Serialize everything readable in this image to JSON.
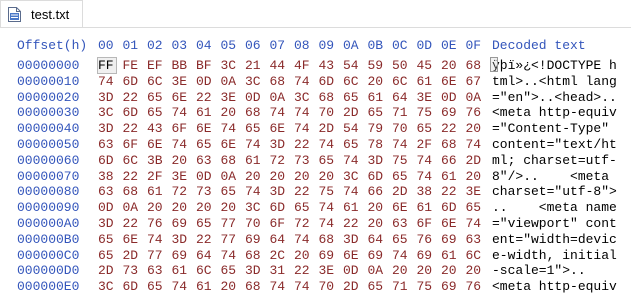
{
  "tab": {
    "label": "test.txt",
    "icon": "hex-file-icon"
  },
  "columns": {
    "offset_header": "Offset(h)",
    "byte_headers": [
      "00",
      "01",
      "02",
      "03",
      "04",
      "05",
      "06",
      "07",
      "08",
      "09",
      "0A",
      "0B",
      "0C",
      "0D",
      "0E",
      "0F"
    ],
    "decoded_header": "Decoded text"
  },
  "rows": [
    {
      "offset": "00000000",
      "bytes": [
        "FF",
        "FE",
        "EF",
        "BB",
        "BF",
        "3C",
        "21",
        "44",
        "4F",
        "43",
        "54",
        "59",
        "50",
        "45",
        "20",
        "68"
      ],
      "text": "ÿþï»¿<!DOCTYPE h"
    },
    {
      "offset": "00000010",
      "bytes": [
        "74",
        "6D",
        "6C",
        "3E",
        "0D",
        "0A",
        "3C",
        "68",
        "74",
        "6D",
        "6C",
        "20",
        "6C",
        "61",
        "6E",
        "67"
      ],
      "text": "tml>..<html lang"
    },
    {
      "offset": "00000020",
      "bytes": [
        "3D",
        "22",
        "65",
        "6E",
        "22",
        "3E",
        "0D",
        "0A",
        "3C",
        "68",
        "65",
        "61",
        "64",
        "3E",
        "0D",
        "0A"
      ],
      "text": "=\"en\">..<head>.."
    },
    {
      "offset": "00000030",
      "bytes": [
        "3C",
        "6D",
        "65",
        "74",
        "61",
        "20",
        "68",
        "74",
        "74",
        "70",
        "2D",
        "65",
        "71",
        "75",
        "69",
        "76"
      ],
      "text": "<meta http-equiv"
    },
    {
      "offset": "00000040",
      "bytes": [
        "3D",
        "22",
        "43",
        "6F",
        "6E",
        "74",
        "65",
        "6E",
        "74",
        "2D",
        "54",
        "79",
        "70",
        "65",
        "22",
        "20"
      ],
      "text": "=\"Content-Type\" "
    },
    {
      "offset": "00000050",
      "bytes": [
        "63",
        "6F",
        "6E",
        "74",
        "65",
        "6E",
        "74",
        "3D",
        "22",
        "74",
        "65",
        "78",
        "74",
        "2F",
        "68",
        "74"
      ],
      "text": "content=\"text/ht"
    },
    {
      "offset": "00000060",
      "bytes": [
        "6D",
        "6C",
        "3B",
        "20",
        "63",
        "68",
        "61",
        "72",
        "73",
        "65",
        "74",
        "3D",
        "75",
        "74",
        "66",
        "2D"
      ],
      "text": "ml; charset=utf-"
    },
    {
      "offset": "00000070",
      "bytes": [
        "38",
        "22",
        "2F",
        "3E",
        "0D",
        "0A",
        "20",
        "20",
        "20",
        "20",
        "3C",
        "6D",
        "65",
        "74",
        "61",
        "20"
      ],
      "text": "8\"/>..    <meta "
    },
    {
      "offset": "00000080",
      "bytes": [
        "63",
        "68",
        "61",
        "72",
        "73",
        "65",
        "74",
        "3D",
        "22",
        "75",
        "74",
        "66",
        "2D",
        "38",
        "22",
        "3E"
      ],
      "text": "charset=\"utf-8\">"
    },
    {
      "offset": "00000090",
      "bytes": [
        "0D",
        "0A",
        "20",
        "20",
        "20",
        "20",
        "3C",
        "6D",
        "65",
        "74",
        "61",
        "20",
        "6E",
        "61",
        "6D",
        "65"
      ],
      "text": "..    <meta name"
    },
    {
      "offset": "000000A0",
      "bytes": [
        "3D",
        "22",
        "76",
        "69",
        "65",
        "77",
        "70",
        "6F",
        "72",
        "74",
        "22",
        "20",
        "63",
        "6F",
        "6E",
        "74"
      ],
      "text": "=\"viewport\" cont"
    },
    {
      "offset": "000000B0",
      "bytes": [
        "65",
        "6E",
        "74",
        "3D",
        "22",
        "77",
        "69",
        "64",
        "74",
        "68",
        "3D",
        "64",
        "65",
        "76",
        "69",
        "63"
      ],
      "text": "ent=\"width=devic"
    },
    {
      "offset": "000000C0",
      "bytes": [
        "65",
        "2D",
        "77",
        "69",
        "64",
        "74",
        "68",
        "2C",
        "20",
        "69",
        "6E",
        "69",
        "74",
        "69",
        "61",
        "6C"
      ],
      "text": "e-width, initial"
    },
    {
      "offset": "000000D0",
      "bytes": [
        "2D",
        "73",
        "63",
        "61",
        "6C",
        "65",
        "3D",
        "31",
        "22",
        "3E",
        "0D",
        "0A",
        "20",
        "20",
        "20",
        "20"
      ],
      "text": "-scale=1\">..    "
    },
    {
      "offset": "000000E0",
      "bytes": [
        "3C",
        "6D",
        "65",
        "74",
        "61",
        "20",
        "68",
        "74",
        "74",
        "70",
        "2D",
        "65",
        "71",
        "75",
        "69",
        "76"
      ],
      "text": "<meta http-equiv"
    }
  ]
}
